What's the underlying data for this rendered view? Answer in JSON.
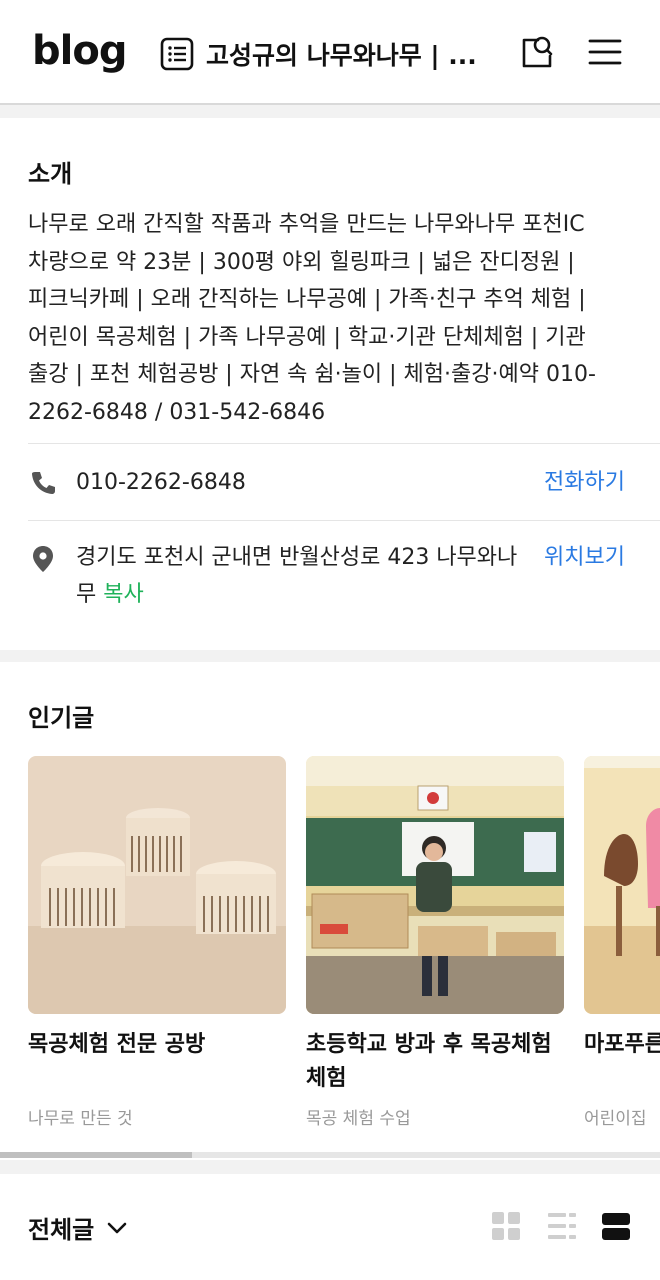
{
  "header": {
    "logo": "blog",
    "blog_title": "고성규의 나무와나무 | ...",
    "icons": {
      "title": "list-document-icon",
      "search": "search-icon",
      "menu": "hamburger-menu-icon"
    }
  },
  "intro": {
    "heading": "소개",
    "description": "나무로 오래 간직할 작품과 추억을 만드는 나무와나무 포천IC 차량으로 약 23분 | 300평 야외 힐링파크 | 넓은 잔디정원 | 피크닉카페 | 오래 간직하는 나무공예 | 가족·친구 추억 체험 | 어린이 목공체험 | 가족 나무공예 | 학교·기관 단체체험 | 기관 출강 | 포천 체험공방 | 자연 속 쉼·놀이 | 체험·출강·예약 010-2262-6848 / 031-542-6846",
    "phone": "010-2262-6848",
    "phone_action": "전화하기",
    "address": "경기도 포천시 군내면 반월산성로 423 나무와나무",
    "copy_label": "복사",
    "map_action": "위치보기"
  },
  "popular": {
    "heading": "인기글",
    "cards": [
      {
        "title": "목공체험 전문 공방",
        "category": "나무로 만든 것"
      },
      {
        "title": "초등학교 방과 후 목공체험 체험",
        "category": "목공 체험 수업"
      },
      {
        "title": "마포푸른",
        "category": "어린이집"
      }
    ]
  },
  "listbar": {
    "label": "전체글",
    "views": [
      "grid-view-icon",
      "list-view-icon",
      "card-view-icon"
    ],
    "active_view": "card-view-icon"
  },
  "colors": {
    "link_blue": "#2a7ae2",
    "copy_green": "#1fb25a",
    "muted": "#999999"
  }
}
